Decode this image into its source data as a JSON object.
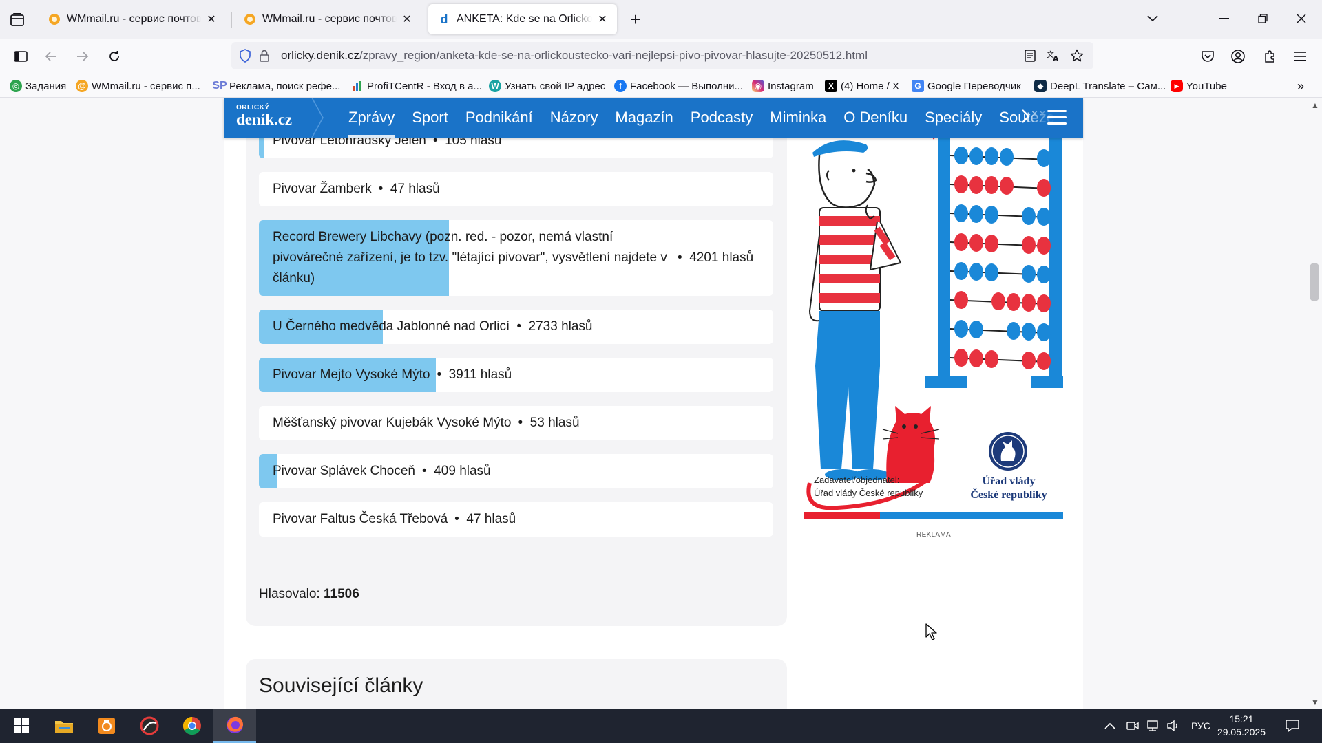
{
  "browser": {
    "tabs": [
      {
        "title": "WMmail.ru - сервис почтовых рассылок",
        "active": false
      },
      {
        "title": "WMmail.ru - сервис почтовых рассылок",
        "active": false
      },
      {
        "title": "ANKETA: Kde se na Orlickoústecku vaří nejlepší pivo",
        "active": true
      }
    ],
    "new_tab_label": "+",
    "url_domain": "orlicky.denik.cz",
    "url_path": "/zpravy_region/anketa-kde-se-na-orlickoustecko-vari-nejlepsi-pivo-pivovar-hlasujte-20250512.html",
    "bookmarks": [
      {
        "label": "Задания",
        "icon": "target-icon",
        "color": "#2ea44f"
      },
      {
        "label": "WMmail.ru - сервис п...",
        "icon": "wmmail-icon",
        "color": "#f5a623"
      },
      {
        "label": "Реклама, поиск рефе...",
        "icon": "sp-icon",
        "color": "#6b7bd6"
      },
      {
        "label": "ProfiTCentR - Вход в а...",
        "icon": "chart-icon",
        "color": "#d04a2a"
      },
      {
        "label": "Узнать свой IP адрес",
        "icon": "ip-icon",
        "color": "#1aa3a3"
      },
      {
        "label": "Facebook — Выполни...",
        "icon": "facebook-icon",
        "color": "#1877f2"
      },
      {
        "label": "Instagram",
        "icon": "instagram-icon",
        "color": "#d62976"
      },
      {
        "label": "(4) Home / X",
        "icon": "x-icon",
        "color": "#000000"
      },
      {
        "label": "Google Переводчик",
        "icon": "translate-icon",
        "color": "#4285f4"
      },
      {
        "label": "DeepL Translate – Сам...",
        "icon": "deepl-icon",
        "color": "#0f2b46"
      },
      {
        "label": "YouTube",
        "icon": "youtube-icon",
        "color": "#ff0000"
      }
    ]
  },
  "site": {
    "logo_top": "ORLICKÝ",
    "logo_main": "deník.cz",
    "nav": [
      "Zprávy",
      "Sport",
      "Podnikání",
      "Názory",
      "Magazín",
      "Podcasty",
      "Miminka",
      "O Deníku",
      "Speciály",
      "Soutěže"
    ],
    "nav_active": 0,
    "accent": "#1a73c8",
    "bar_color": "#7ec8ef"
  },
  "poll": {
    "total_votes": 11506,
    "items": [
      {
        "name": "Pivovar Letohradský Jelen",
        "votes_text": "105 hlasů",
        "votes": 105
      },
      {
        "name": "Pivovar Žamberk",
        "votes_text": "47 hlasů",
        "votes": 47
      },
      {
        "name": "Record Brewery Libchavy (pozn. red. - pozor, nemá vlastní pivovárečné zařízení, je to tzv. \"létající pivovar\", vysvětlení najdete v článku)",
        "votes_text": "4201 hlasů",
        "votes": 4201
      },
      {
        "name": "U Černého medvěda Jablonné nad Orlicí",
        "votes_text": "2733 hlasů",
        "votes": 2733
      },
      {
        "name": "Pivovar Mejto Vysoké Mýto",
        "votes_text": "3911 hlasů",
        "votes": 3911
      },
      {
        "name": "Měšťanský pivovar Kujebák Vysoké Mýto",
        "votes_text": "53 hlasů",
        "votes": 53
      },
      {
        "name": "Pivovar Splávek Choceň",
        "votes_text": "409 hlasů",
        "votes": 409
      },
      {
        "name": "Pivovar Faltus Česká Třebová",
        "votes_text": "47 hlasů",
        "votes": 47
      }
    ],
    "separator": "•",
    "total_label": "Hlasovalo:",
    "total_value": "11506"
  },
  "related": {
    "title": "Související články"
  },
  "ad": {
    "sponsor_line1": "Zadavatel/objednatel:",
    "sponsor_line2": "Úřad vlády České republiky",
    "org_line1": "Úřad vlády",
    "org_line2": "České republiky",
    "label": "REKLAMA"
  },
  "taskbar": {
    "language": "РУС",
    "time": "15:21",
    "date": "29.05.2025"
  }
}
